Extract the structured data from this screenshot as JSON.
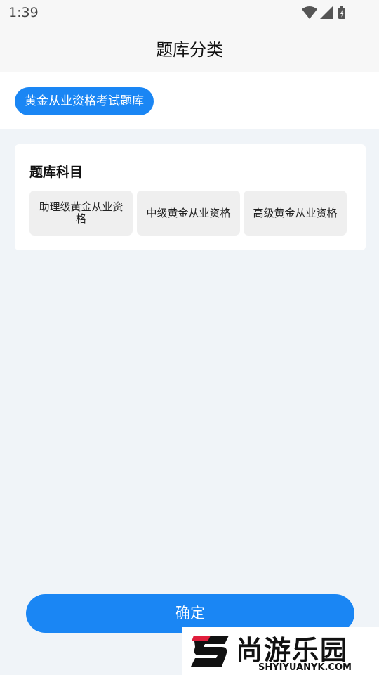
{
  "status_bar": {
    "time": "1:39"
  },
  "header": {
    "title": "题库分类"
  },
  "category": {
    "selected_label": "黄金从业资格考试题库"
  },
  "subjects": {
    "title": "题库科目",
    "options": [
      {
        "label": "助理级黄金从业资格"
      },
      {
        "label": "中级黄金从业资格"
      },
      {
        "label": "高级黄金从业资格"
      }
    ]
  },
  "footer": {
    "confirm_label": "确定"
  },
  "watermark": {
    "name": "尚游乐园",
    "domain": "SHYIYUANYK.COM"
  },
  "colors": {
    "accent": "#1a86f4",
    "option_bg": "#efefef",
    "page_bg": "#f0f4f8"
  }
}
